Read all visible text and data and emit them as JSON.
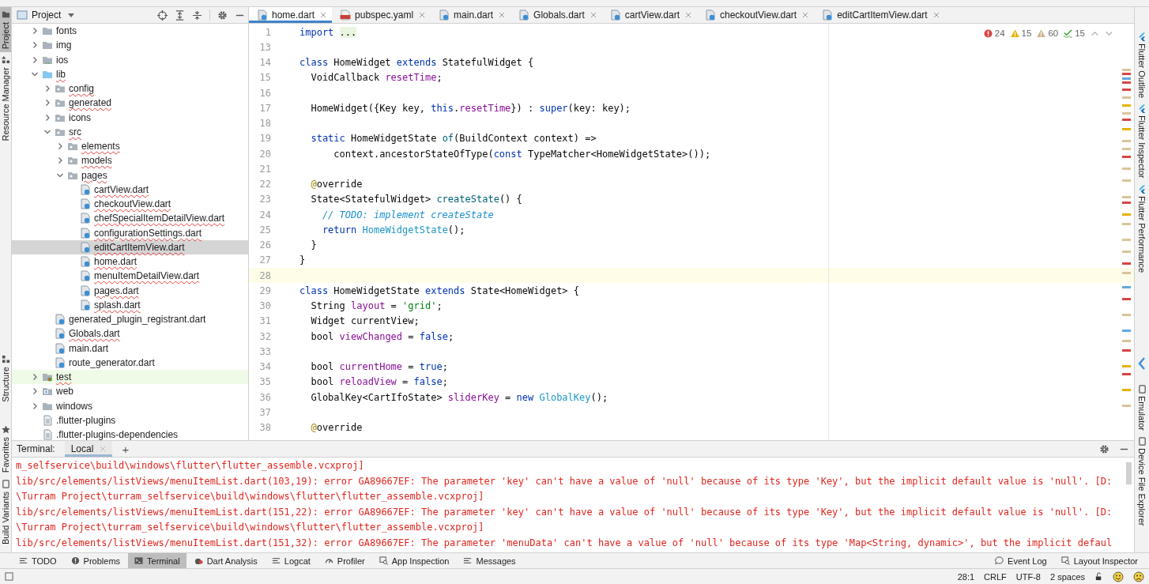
{
  "left_strip": [
    {
      "label": "Project",
      "kind": "folder",
      "selected": true
    },
    {
      "label": "Resource Manager",
      "kind": "shapes",
      "selected": false
    },
    {
      "label": "Structure",
      "kind": "structure",
      "selected": false
    },
    {
      "label": "Favorites",
      "kind": "star",
      "selected": false
    },
    {
      "label": "Build Variants",
      "kind": "device",
      "selected": false
    }
  ],
  "project": {
    "title": "Project",
    "tree": [
      {
        "label": "fonts",
        "kind": "folder",
        "expanded": false,
        "selected": false,
        "error": false
      },
      {
        "label": "img",
        "kind": "folder",
        "expanded": false,
        "selected": false,
        "error": false
      },
      {
        "label": "ios",
        "kind": "ios-folder",
        "expanded": false,
        "selected": false,
        "error": false
      },
      {
        "label": "lib",
        "kind": "source-folder",
        "expanded": true,
        "selected": false,
        "error": true,
        "children": [
          {
            "label": "config",
            "kind": "package",
            "expanded": false,
            "selected": false,
            "error": true
          },
          {
            "label": "generated",
            "kind": "package",
            "expanded": false,
            "selected": false,
            "error": true
          },
          {
            "label": "icons",
            "kind": "package",
            "expanded": false,
            "selected": false,
            "error": false
          },
          {
            "label": "src",
            "kind": "package",
            "expanded": true,
            "selected": false,
            "error": true,
            "children": [
              {
                "label": "elements",
                "kind": "package",
                "expanded": false,
                "selected": false,
                "error": true
              },
              {
                "label": "models",
                "kind": "package",
                "expanded": false,
                "selected": false,
                "error": true
              },
              {
                "label": "pages",
                "kind": "package",
                "expanded": true,
                "selected": false,
                "error": true,
                "children": [
                  {
                    "label": "cartView.dart",
                    "kind": "dart",
                    "selected": false,
                    "error": true
                  },
                  {
                    "label": "checkoutView.dart",
                    "kind": "dart",
                    "selected": false,
                    "error": true
                  },
                  {
                    "label": "chefSpecialItemDetailView.dart",
                    "kind": "dart",
                    "selected": false,
                    "error": true
                  },
                  {
                    "label": "configurationSettings.dart",
                    "kind": "dart",
                    "selected": false,
                    "error": true
                  },
                  {
                    "label": "editCartItemView.dart",
                    "kind": "dart",
                    "selected": true,
                    "error": true
                  },
                  {
                    "label": "home.dart",
                    "kind": "dart",
                    "selected": false,
                    "error": true
                  },
                  {
                    "label": "menuItemDetailView.dart",
                    "kind": "dart",
                    "selected": false,
                    "error": true
                  },
                  {
                    "label": "pages.dart",
                    "kind": "dart",
                    "selected": false,
                    "error": true
                  },
                  {
                    "label": "splash.dart",
                    "kind": "dart",
                    "selected": false,
                    "error": true
                  }
                ]
              }
            ]
          },
          {
            "label": "generated_plugin_registrant.dart",
            "kind": "dart",
            "selected": false,
            "error": false
          },
          {
            "label": "Globals.dart",
            "kind": "dart",
            "selected": false,
            "error": true
          },
          {
            "label": "main.dart",
            "kind": "dart",
            "selected": false,
            "error": false
          },
          {
            "label": "route_generator.dart",
            "kind": "dart",
            "selected": false,
            "error": false
          }
        ]
      },
      {
        "label": "test",
        "kind": "test-folder",
        "expanded": false,
        "selected": false,
        "error": true
      },
      {
        "label": "web",
        "kind": "web-folder",
        "expanded": false,
        "selected": false,
        "error": false
      },
      {
        "label": "windows",
        "kind": "folder",
        "expanded": false,
        "selected": false,
        "error": false
      },
      {
        "label": ".flutter-plugins",
        "kind": "file",
        "selected": false,
        "error": false
      },
      {
        "label": ".flutter-plugins-dependencies",
        "kind": "file",
        "selected": false,
        "error": false
      }
    ]
  },
  "editor_tabs": [
    {
      "label": "home.dart",
      "kind": "dart",
      "selected": true
    },
    {
      "label": "pubspec.yaml",
      "kind": "yaml",
      "selected": false
    },
    {
      "label": "main.dart",
      "kind": "dart",
      "selected": false
    },
    {
      "label": "Globals.dart",
      "kind": "dart",
      "selected": false
    },
    {
      "label": "cartView.dart",
      "kind": "dart",
      "selected": false
    },
    {
      "label": "checkoutView.dart",
      "kind": "dart",
      "selected": false
    },
    {
      "label": "editCartItemView.dart",
      "kind": "dart",
      "selected": false
    }
  ],
  "inspections": [
    {
      "kind": "error",
      "count": "24"
    },
    {
      "kind": "warning",
      "count": "15"
    },
    {
      "kind": "weak",
      "count": "60"
    },
    {
      "kind": "typo",
      "count": "15"
    }
  ],
  "code": [
    {
      "number": "1",
      "current": false,
      "tokens": [
        {
          "text": "import ",
          "kind": "keyword"
        },
        {
          "text": "...",
          "kind": "folded"
        }
      ]
    },
    {
      "number": "13",
      "current": false
    },
    {
      "number": "14",
      "current": false,
      "tokens": [
        {
          "text": "class",
          "kind": "keyword"
        },
        {
          "text": " HomeWidget ",
          "kind": "plain"
        },
        {
          "text": "extends",
          "kind": "keyword"
        },
        {
          "text": " StatefulWidget {",
          "kind": "plain"
        }
      ]
    },
    {
      "number": "15",
      "current": false,
      "tokens": [
        {
          "text": "  VoidCallback ",
          "kind": "plain"
        },
        {
          "text": "resetTime",
          "kind": "field"
        },
        {
          "text": ";",
          "kind": "plain"
        }
      ]
    },
    {
      "number": "16",
      "current": false
    },
    {
      "number": "17",
      "current": false,
      "tokens": [
        {
          "text": "  HomeWidget({Key key, ",
          "kind": "plain"
        },
        {
          "text": "this",
          "kind": "keyword"
        },
        {
          "text": ".",
          "kind": "plain"
        },
        {
          "text": "resetTime",
          "kind": "field"
        },
        {
          "text": "}) : ",
          "kind": "plain"
        },
        {
          "text": "super",
          "kind": "keyword"
        },
        {
          "text": "(key: key);",
          "kind": "plain"
        }
      ]
    },
    {
      "number": "18",
      "current": false
    },
    {
      "number": "19",
      "current": false,
      "tokens": [
        {
          "text": "  static",
          "kind": "keyword"
        },
        {
          "text": " HomeWidgetState ",
          "kind": "plain"
        },
        {
          "text": "of",
          "kind": "function"
        },
        {
          "text": "(BuildContext context) =>",
          "kind": "plain"
        }
      ]
    },
    {
      "number": "20",
      "current": false,
      "tokens": [
        {
          "text": "      context.ancestorStateOfType(",
          "kind": "plain"
        },
        {
          "text": "const",
          "kind": "keyword"
        },
        {
          "text": " TypeMatcher<HomeWidgetState>());",
          "kind": "plain"
        }
      ]
    },
    {
      "number": "21",
      "current": false
    },
    {
      "number": "22",
      "current": false,
      "tokens": [
        {
          "text": "  @",
          "kind": "annotation"
        },
        {
          "text": "override",
          "kind": "plain"
        }
      ]
    },
    {
      "number": "23",
      "current": false,
      "tokens": [
        {
          "text": "  State<StatefulWidget> ",
          "kind": "plain"
        },
        {
          "text": "createState",
          "kind": "function"
        },
        {
          "text": "() {",
          "kind": "plain"
        }
      ]
    },
    {
      "number": "24",
      "current": false,
      "tokens": [
        {
          "text": "    // TODO: implement createState",
          "kind": "todo"
        }
      ]
    },
    {
      "number": "25",
      "current": false,
      "tokens": [
        {
          "text": "    return ",
          "kind": "keyword"
        },
        {
          "text": "HomeWidgetState",
          "kind": "constructor"
        },
        {
          "text": "();",
          "kind": "plain"
        }
      ]
    },
    {
      "number": "26",
      "current": false,
      "tokens": [
        {
          "text": "  }",
          "kind": "plain"
        }
      ]
    },
    {
      "number": "27",
      "current": false,
      "tokens": [
        {
          "text": "}",
          "kind": "plain"
        }
      ]
    },
    {
      "number": "28",
      "current": true
    },
    {
      "number": "29",
      "current": false,
      "tokens": [
        {
          "text": "class",
          "kind": "keyword"
        },
        {
          "text": " HomeWidgetState ",
          "kind": "plain"
        },
        {
          "text": "extends",
          "kind": "keyword"
        },
        {
          "text": " State<HomeWidget> {",
          "kind": "plain"
        }
      ]
    },
    {
      "number": "30",
      "current": false,
      "tokens": [
        {
          "text": "  String ",
          "kind": "plain"
        },
        {
          "text": "layout",
          "kind": "field"
        },
        {
          "text": " = ",
          "kind": "plain"
        },
        {
          "text": "'grid'",
          "kind": "string"
        },
        {
          "text": ";",
          "kind": "plain"
        }
      ]
    },
    {
      "number": "31",
      "current": false,
      "tokens": [
        {
          "text": "  Widget currentView;",
          "kind": "plain"
        }
      ]
    },
    {
      "number": "32",
      "current": false,
      "tokens": [
        {
          "text": "  bool ",
          "kind": "plain"
        },
        {
          "text": "viewChanged",
          "kind": "field"
        },
        {
          "text": " = ",
          "kind": "plain"
        },
        {
          "text": "false",
          "kind": "keyword"
        },
        {
          "text": ";",
          "kind": "plain"
        }
      ]
    },
    {
      "number": "33",
      "current": false
    },
    {
      "number": "34",
      "current": false,
      "tokens": [
        {
          "text": "  bool ",
          "kind": "plain"
        },
        {
          "text": "currentHome",
          "kind": "field"
        },
        {
          "text": " = ",
          "kind": "plain"
        },
        {
          "text": "true",
          "kind": "keyword"
        },
        {
          "text": ";",
          "kind": "plain"
        }
      ]
    },
    {
      "number": "35",
      "current": false,
      "tokens": [
        {
          "text": "  bool ",
          "kind": "plain"
        },
        {
          "text": "reloadView",
          "kind": "field"
        },
        {
          "text": " = ",
          "kind": "plain"
        },
        {
          "text": "false",
          "kind": "keyword"
        },
        {
          "text": ";",
          "kind": "plain"
        }
      ]
    },
    {
      "number": "36",
      "current": false,
      "tokens": [
        {
          "text": "  GlobalKey<CartIfoState> ",
          "kind": "plain"
        },
        {
          "text": "sliderKey",
          "kind": "field"
        },
        {
          "text": " = ",
          "kind": "plain"
        },
        {
          "text": "new ",
          "kind": "keyword"
        },
        {
          "text": "GlobalKey",
          "kind": "constructor"
        },
        {
          "text": "();",
          "kind": "plain"
        }
      ]
    },
    {
      "number": "37",
      "current": false
    },
    {
      "number": "38",
      "current": false,
      "tokens": [
        {
          "text": "  @",
          "kind": "annotation"
        },
        {
          "text": "override",
          "kind": "plain"
        }
      ]
    }
  ],
  "right_strip": [
    {
      "label": "Flutter Outline",
      "kind": "flutter"
    },
    {
      "label": "Flutter Inspector",
      "kind": "flutter"
    },
    {
      "label": "Flutter Performance",
      "kind": "flutter"
    },
    {
      "label": "Emulator",
      "kind": "device"
    },
    {
      "label": "Device File Explorer",
      "kind": "device"
    }
  ],
  "terminal": {
    "title": "Terminal:",
    "tabs": [
      {
        "label": "Local",
        "selected": true
      }
    ],
    "add": "+",
    "lines": [
      "m_selfservice\\build\\windows\\flutter\\flutter_assemble.vcxproj]",
      "lib/src/elements/listViews/menuItemList.dart(103,19): error GA89667EF: The parameter 'key' can't have a value of 'null' because of its type 'Key', but the implicit default value is 'null'. [D:",
      "\\Turram Project\\turram_selfservice\\build\\windows\\flutter\\flutter_assemble.vcxproj]",
      "lib/src/elements/listViews/menuItemList.dart(151,22): error GA89667EF: The parameter 'key' can't have a value of 'null' because of its type 'Key', but the implicit default value is 'null'. [D:",
      "\\Turram Project\\turram_selfservice\\build\\windows\\flutter\\flutter_assemble.vcxproj]",
      "lib/src/elements/listViews/menuItemList.dart(151,32): error GA89667EF: The parameter 'menuData' can't have a value of 'null' because of its type 'Map<String, dynamic>', but the implicit defaul"
    ]
  },
  "tool_windows": [
    {
      "label": "TODO",
      "kind": "list",
      "selected": false
    },
    {
      "label": "Problems",
      "kind": "alert",
      "selected": false
    },
    {
      "label": "Terminal",
      "kind": "terminal",
      "selected": true
    },
    {
      "label": "Dart Analysis",
      "kind": "dart-analysis",
      "selected": false
    },
    {
      "label": "Logcat",
      "kind": "lines",
      "selected": false
    },
    {
      "label": "Profiler",
      "kind": "gauge",
      "selected": false
    },
    {
      "label": "App Inspection",
      "kind": "inspect",
      "selected": false
    },
    {
      "label": "Messages",
      "kind": "lines",
      "selected": false
    }
  ],
  "tool_windows_right": [
    {
      "label": "Event Log",
      "kind": "bubble"
    },
    {
      "label": "Layout Inspector",
      "kind": "inspect"
    }
  ],
  "status_bar": {
    "items": [
      "28:1",
      "CRLF",
      "UTF-8",
      "2 spaces"
    ]
  }
}
